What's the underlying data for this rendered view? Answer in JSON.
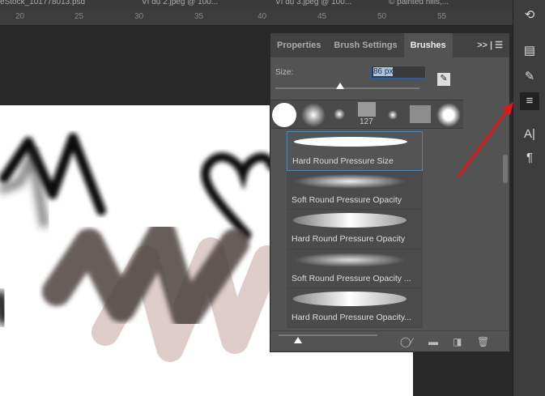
{
  "doc_tabs": [
    "eStock_101778013.psd",
    "Ví dụ 2.jpeg @ 100...",
    "Ví dụ 3.jpeg @ 100...",
    "© painted hills,..."
  ],
  "ruler_ticks": [
    "20",
    "25",
    "30",
    "35",
    "40",
    "45",
    "50",
    "55"
  ],
  "panel": {
    "tabs": [
      {
        "label": "Properties"
      },
      {
        "label": "Brush Settings"
      },
      {
        "label": "Brushes",
        "active": true
      }
    ],
    "overflow": ">>",
    "size_label": "Size:",
    "size_value": "86 px",
    "size_slider_fraction": 0.45,
    "preset_count_label": "127",
    "brushes": [
      {
        "name": "Hard Round Pressure Size",
        "selected": true
      },
      {
        "name": "Soft Round Pressure Opacity"
      },
      {
        "name": "Hard Round Pressure Opacity"
      },
      {
        "name": "Soft Round Pressure Opacity ..."
      },
      {
        "name": "Hard Round Pressure Opacity..."
      }
    ],
    "preview_slider_fraction": 0.2
  },
  "colors": {
    "accent_arrow": "#e01818",
    "selection": "#4a8ab0"
  }
}
